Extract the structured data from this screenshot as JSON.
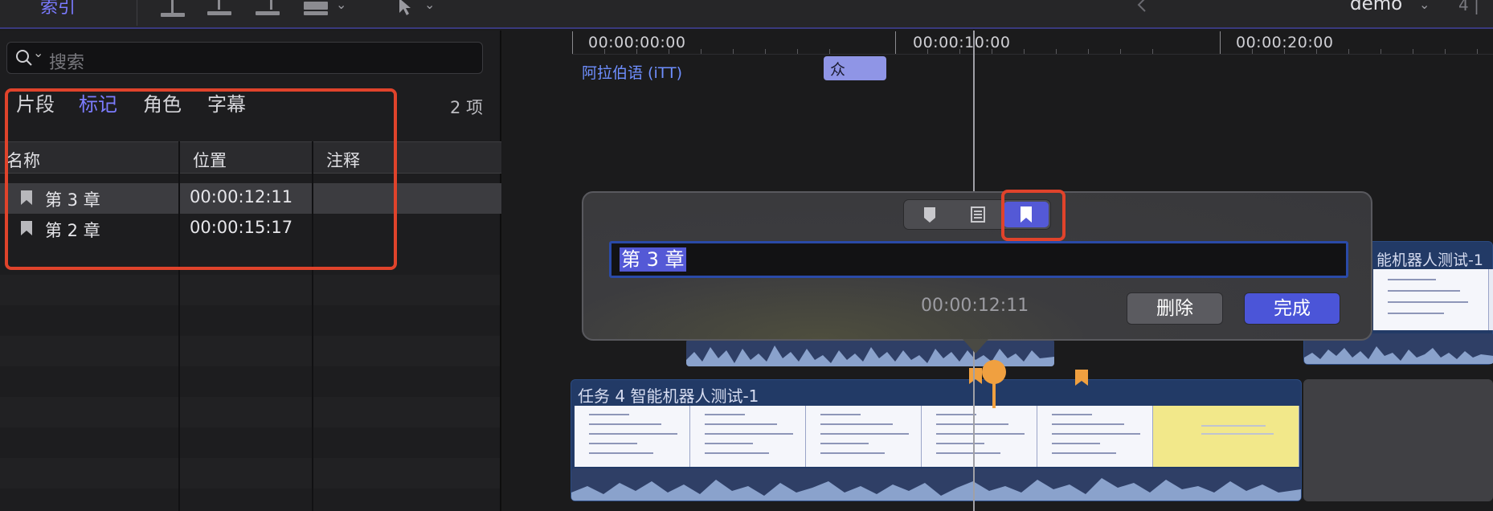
{
  "toolbar": {
    "index_tab": "索引",
    "project_name": "demo",
    "page_indicator": "4 |"
  },
  "index": {
    "search_placeholder": "搜索",
    "tabs": [
      "片段",
      "标记",
      "角色",
      "字幕"
    ],
    "active_tab": "标记",
    "count": "2 项",
    "columns": [
      "名称",
      "位置",
      "注释"
    ],
    "rows": [
      {
        "name": "第 3 章",
        "position": "00:00:12:11",
        "note": ""
      },
      {
        "name": "第 2 章",
        "position": "00:00:15:17",
        "note": ""
      }
    ]
  },
  "timeline": {
    "timecodes": [
      "00:00:00:00",
      "00:00:10:00",
      "00:00:20:00"
    ],
    "caption_lane": "阿拉伯语 (iTT)",
    "caption_clip": "众",
    "story_clip_title": "任务 4 智能机器人测试-1",
    "right_clip_title": "能机器人测试-1"
  },
  "popover": {
    "marker_name": "第 3 章",
    "timecode": "00:00:12:11",
    "delete_label": "删除",
    "done_label": "完成",
    "types": [
      "standard-marker",
      "todo-marker",
      "chapter-marker"
    ],
    "selected_type": "chapter-marker"
  },
  "colors": {
    "accent": "#5459d6",
    "highlight_box": "#e0432b",
    "marker": "#f0a040",
    "clip": "#223a66"
  }
}
